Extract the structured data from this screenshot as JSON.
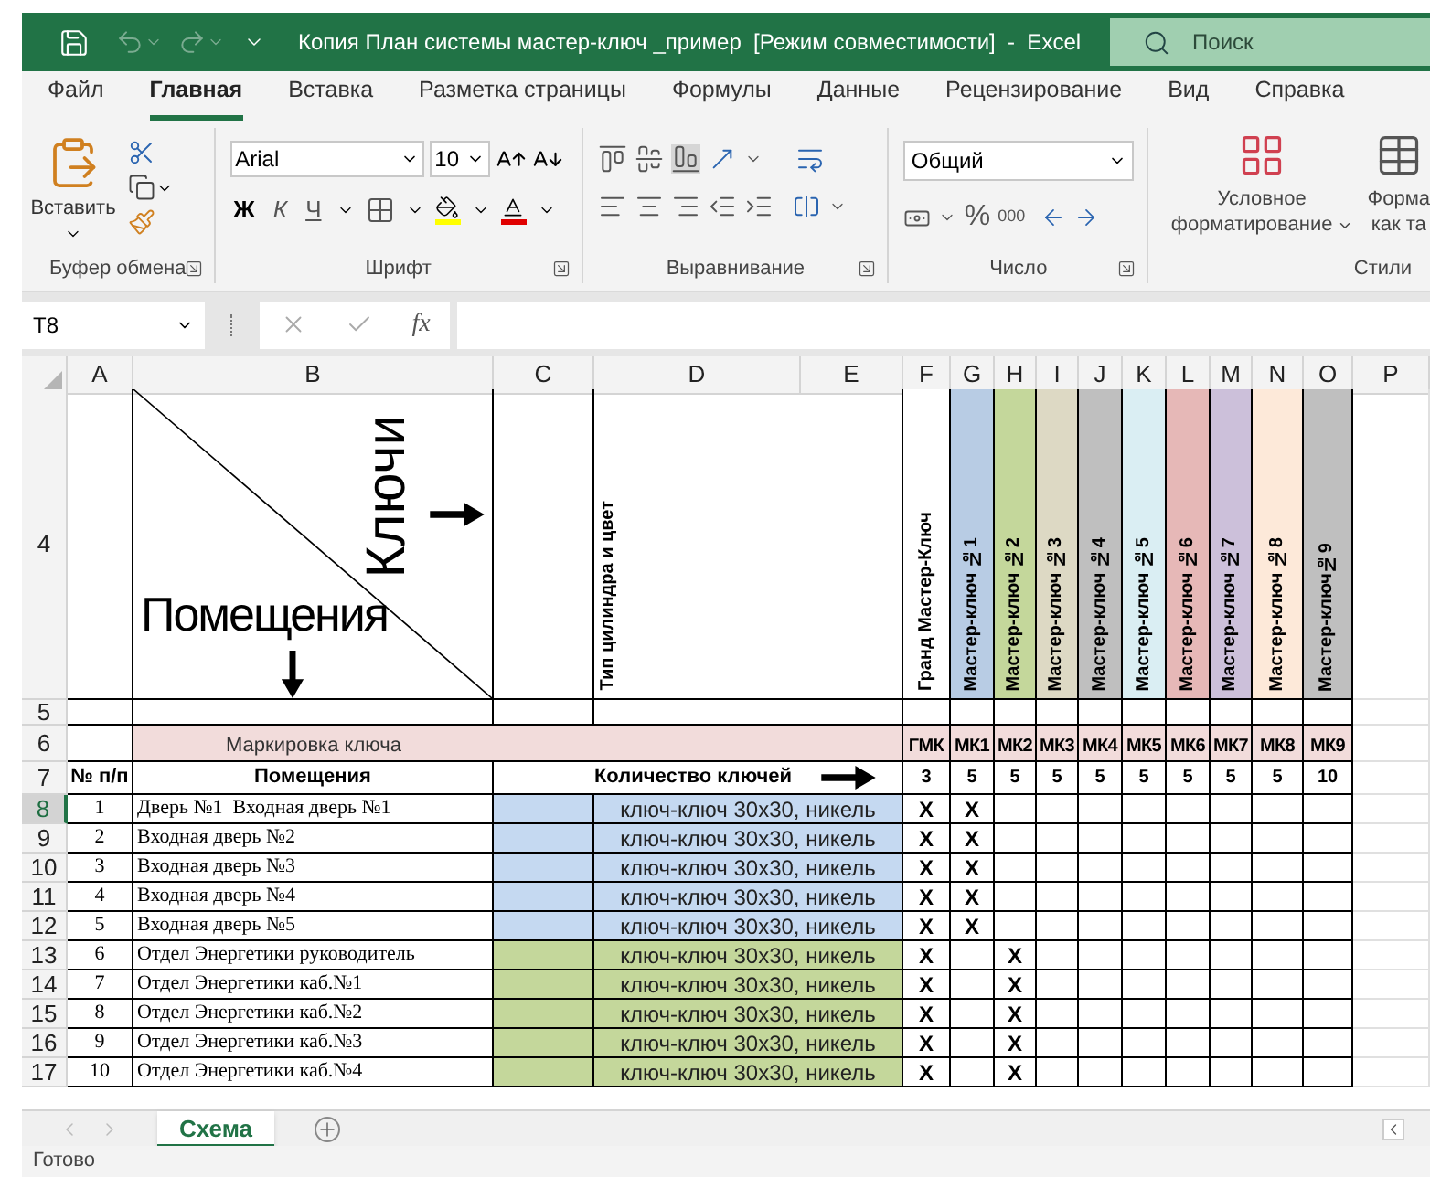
{
  "title_bar": {
    "title": "Копия План системы мастер-ключ _пример  [Режим совместимости]  -  Excel",
    "search": {
      "placeholder": "Поиск"
    }
  },
  "menu_tabs": [
    {
      "label": "Файл",
      "selected": false
    },
    {
      "label": "Главная",
      "selected": true
    },
    {
      "label": "Вставка",
      "selected": false
    },
    {
      "label": "Разметка страницы",
      "selected": false
    },
    {
      "label": "Формулы",
      "selected": false
    },
    {
      "label": "Данные",
      "selected": false
    },
    {
      "label": "Рецензирование",
      "selected": false
    },
    {
      "label": "Вид",
      "selected": false
    },
    {
      "label": "Справка",
      "selected": false
    }
  ],
  "ribbon": {
    "clipboard": {
      "paste": "Вставить",
      "label": "Буфер обмена"
    },
    "font": {
      "name": "Arial",
      "size": "10",
      "bold": "Ж",
      "italic": "К",
      "underline": "Ч",
      "label": "Шрифт"
    },
    "alignment": {
      "label": "Выравнивание"
    },
    "number": {
      "format": "Общий",
      "percent": "%",
      "thousands": "000",
      "label": "Число"
    },
    "styles": {
      "conditional": [
        "Условное",
        "форматирование"
      ],
      "format_table": [
        "Форма",
        "как та"
      ],
      "label": "Стили"
    }
  },
  "formula_bar": {
    "name_box": "T8",
    "function": "fx"
  },
  "sheet": {
    "columns": [
      "A",
      "B",
      "C",
      "D",
      "E",
      "F",
      "G",
      "H",
      "I",
      "J",
      "K",
      "L",
      "M",
      "N",
      "O",
      "P"
    ],
    "key_header": {
      "row": "4",
      "keys_label": "Ключи",
      "rooms_label": "Помещения",
      "cylinder_label": "Тип цилиндра и цвет",
      "keys": [
        {
          "name": "Гранд Мастер-Ключ",
          "color": "#ffffff"
        },
        {
          "name": "Мастер-ключ №1",
          "color": "#b8cce4"
        },
        {
          "name": "Мастер-ключ №2",
          "color": "#c4d79b"
        },
        {
          "name": "Мастер-ключ №3",
          "color": "#ddd9c4"
        },
        {
          "name": "Мастер-ключ №4",
          "color": "#bfbfbf"
        },
        {
          "name": "Мастер-ключ №5",
          "color": "#daeef3"
        },
        {
          "name": "Мастер-ключ №6",
          "color": "#e6b8b7"
        },
        {
          "name": "Мастер-ключ №7",
          "color": "#ccc0da"
        },
        {
          "name": "Мастер-ключ №8",
          "color": "#fde9d9"
        },
        {
          "name": "Мастер-ключ№9",
          "color": "#bfbfbf"
        }
      ]
    },
    "blank_row": {
      "row": "5"
    },
    "marking_row": {
      "row": "6",
      "label": "Маркировка ключа",
      "codes": [
        "ГМК",
        "МК1",
        "МК2",
        "МК3",
        "МК4",
        "МК5",
        "МК6",
        "МК7",
        "МК8",
        "МК9"
      ]
    },
    "count_row": {
      "row": "7",
      "number_label": "№ п/п",
      "rooms_label": "Помещения",
      "count_label": "Количество ключей",
      "counts": [
        "3",
        "5",
        "5",
        "5",
        "5",
        "5",
        "5",
        "5",
        "5",
        "10"
      ]
    },
    "rows": [
      {
        "row": "8",
        "selected": true,
        "number": "1",
        "room": "Дверь №1  Входная дверь №1",
        "cylinder": "ключ-ключ 30х30, никель",
        "color": "#c5d9f1",
        "marks": {
          "F": "X",
          "G": "X"
        }
      },
      {
        "row": "9",
        "selected": false,
        "number": "2",
        "room": "Входная дверь №2",
        "cylinder": "ключ-ключ 30х30, никель",
        "color": "#c5d9f1",
        "marks": {
          "F": "X",
          "G": "X"
        }
      },
      {
        "row": "10",
        "selected": false,
        "number": "3",
        "room": "Входная дверь №3",
        "cylinder": "ключ-ключ 30х30, никель",
        "color": "#c5d9f1",
        "marks": {
          "F": "X",
          "G": "X"
        }
      },
      {
        "row": "11",
        "selected": false,
        "number": "4",
        "room": "Входная дверь №4",
        "cylinder": "ключ-ключ 30х30, никель",
        "color": "#c5d9f1",
        "marks": {
          "F": "X",
          "G": "X"
        }
      },
      {
        "row": "12",
        "selected": false,
        "number": "5",
        "room": "Входная дверь №5",
        "cylinder": "ключ-ключ 30х30, никель",
        "color": "#c5d9f1",
        "marks": {
          "F": "X",
          "G": "X"
        }
      },
      {
        "row": "13",
        "selected": false,
        "number": "6",
        "room": "Отдел Энергетики руководитель",
        "cylinder": "ключ-ключ 30х30, никель",
        "color": "#c4d79b",
        "marks": {
          "F": "X",
          "H": "X"
        }
      },
      {
        "row": "14",
        "selected": false,
        "number": "7",
        "room": "Отдел Энергетики каб.№1",
        "cylinder": "ключ-ключ 30х30, никель",
        "color": "#c4d79b",
        "marks": {
          "F": "X",
          "H": "X"
        }
      },
      {
        "row": "15",
        "selected": false,
        "number": "8",
        "room": "Отдел Энергетики каб.№2",
        "cylinder": "ключ-ключ 30х30, никель",
        "color": "#c4d79b",
        "marks": {
          "F": "X",
          "H": "X"
        }
      },
      {
        "row": "16",
        "selected": false,
        "number": "9",
        "room": "Отдел Энергетики каб.№3",
        "cylinder": "ключ-ключ 30х30, никель",
        "color": "#c4d79b",
        "marks": {
          "F": "X",
          "H": "X"
        }
      },
      {
        "row": "17",
        "selected": false,
        "number": "10",
        "room": "Отдел Энергетики каб.№4",
        "cylinder": "ключ-ключ 30х30, никель",
        "color": "#c4d79b",
        "marks": {
          "F": "X",
          "H": "X"
        }
      }
    ]
  },
  "sheet_tabs": [
    {
      "label": "Схема",
      "selected": true
    }
  ],
  "status_bar": {
    "status": "Готово"
  }
}
